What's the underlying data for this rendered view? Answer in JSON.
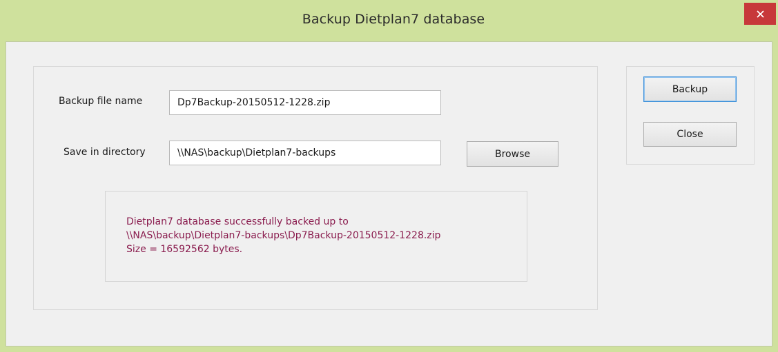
{
  "window": {
    "title": "Backup Dietplan7 database",
    "close_icon": "close-x-icon",
    "accent_color": "#cfe19d",
    "close_color": "#c7383a"
  },
  "form": {
    "file_name_label": "Backup file name",
    "file_name_value": "Dp7Backup-20150512-1228.zip",
    "directory_label": "Save in directory",
    "directory_value": "\\\\NAS\\backup\\Dietplan7-backups",
    "browse_label": "Browse"
  },
  "status": {
    "line1": "Dietplan7 database successfully backed up to",
    "line2": "\\\\NAS\\backup\\Dietplan7-backups\\Dp7Backup-20150512-1228.zip",
    "line3": "Size = 16592562 bytes.",
    "color": "#8a1c4e"
  },
  "actions": {
    "backup_label": "Backup",
    "close_label": "Close"
  }
}
